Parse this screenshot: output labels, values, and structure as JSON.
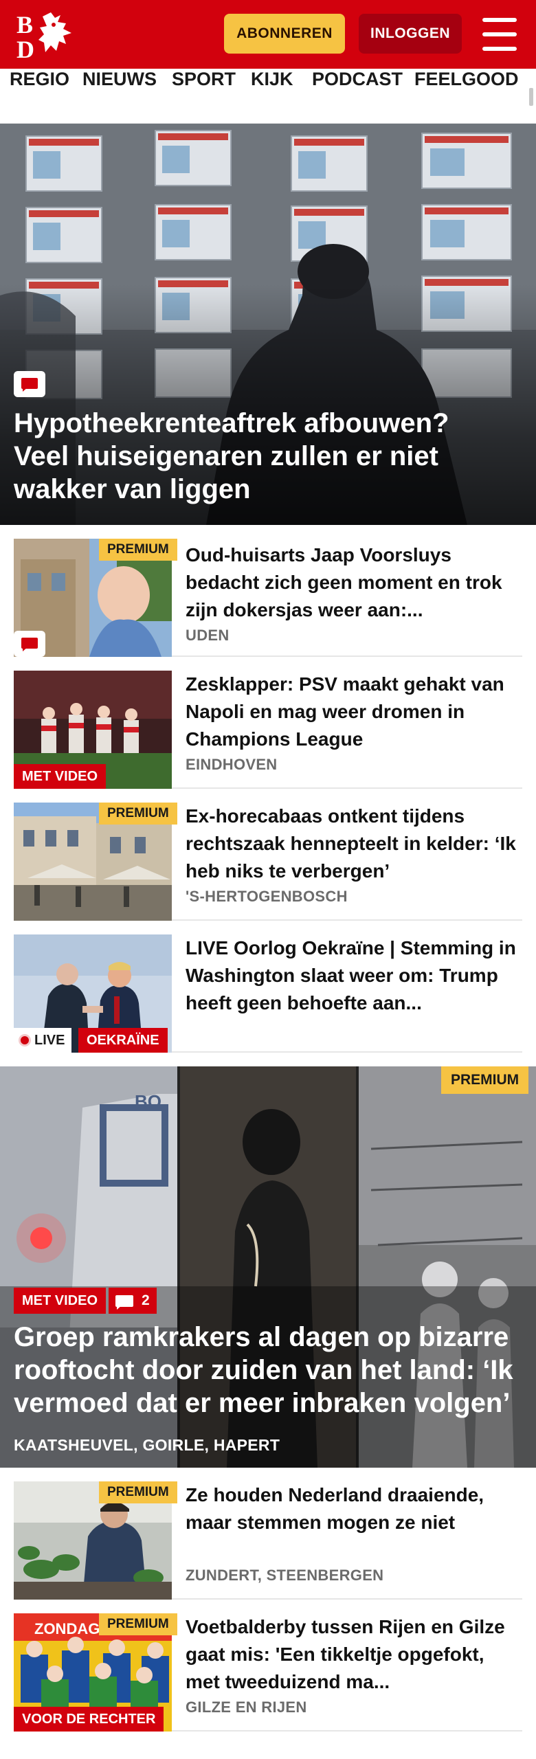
{
  "header": {
    "logo_text": "BD",
    "subscribe_label": "ABONNEREN",
    "login_label": "INLOGGEN",
    "menu_icon": "hamburger-menu-icon",
    "brand_color": "#d2010d",
    "subscribe_color": "#f6c343"
  },
  "nav": {
    "items": [
      "REGIO",
      "NIEUWS",
      "SPORT",
      "KIJK",
      "PODCAST",
      "FEELGOOD"
    ]
  },
  "hero": {
    "title": "Hypotheekrenteaftrek afbouwen? Veel huiseigenaren zullen er niet wakker van liggen",
    "comment_icon": "comment-icon"
  },
  "articles": [
    {
      "title": "Oud-huisarts Jaap Voorsluys bedacht zich geen moment en trok zijn dokersjas weer aan:...",
      "location": "UDEN",
      "badge": "PREMIUM",
      "comment_icon": "comment-icon"
    },
    {
      "title": "Zesklapper: PSV maakt gehakt van Napoli en mag weer dromen in Champions League",
      "location": "EINDHOVEN",
      "label": "MET VIDEO"
    },
    {
      "title": "Ex-horecabaas ontkent tijdens rechtszaak hennepteelt in kelder: ‘Ik heb niks te verbergen’",
      "location": "'S-HERTOGENBOSCH",
      "badge": "PREMIUM"
    },
    {
      "title": "LIVE Oorlog Oekraïne | Stemming in Washington slaat weer om: Trump heeft geen behoefte aan...",
      "live_label": "LIVE",
      "label": "OEKRAÏNE"
    }
  ],
  "feature": {
    "title": "Groep ramkrakers al dagen op bizarre rooftocht door zuiden van het land: ‘Ik vermoed dat er meer inbraken volgen’",
    "location": "KAATSHEUVEL, GOIRLE, HAPERT",
    "badge": "PREMIUM",
    "label": "MET VIDEO",
    "comment_count": "2",
    "van_lettering": "BO"
  },
  "articles2": [
    {
      "title": "Ze houden Nederland draaiende, maar stemmen mogen ze niet",
      "location": "ZUNDERT, STEENBERGEN",
      "badge": "PREMIUM"
    },
    {
      "title": "Voetbalderby tussen Rijen en Gilze gaat mis: 'Een tikkeltje opgefokt, met tweeduizend ma...",
      "location": "GILZE EN RIJEN",
      "badge": "PREMIUM",
      "label": "VOOR DE RECHTER",
      "thumb_text": "ZONDAG 1"
    }
  ]
}
